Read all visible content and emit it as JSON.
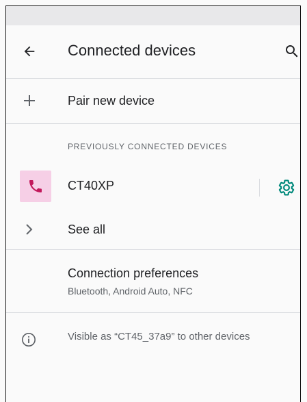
{
  "app_bar": {
    "title": "Connected devices",
    "back_icon": "arrow-back-icon",
    "search_icon": "search-icon"
  },
  "pair_new": {
    "label": "Pair new device",
    "icon": "plus-icon"
  },
  "previously_connected": {
    "header": "PREVIOUSLY CONNECTED DEVICES",
    "devices": [
      {
        "name": "CT40XP",
        "icon": "phone-icon",
        "settings_icon": "gear-icon"
      }
    ],
    "see_all_label": "See all",
    "see_all_icon": "chevron-right-icon"
  },
  "connection_preferences": {
    "label": "Connection preferences",
    "summary": "Bluetooth, Android Auto, NFC"
  },
  "visibility": {
    "text": "Visible as “CT45_37a9” to other devices",
    "icon": "info-icon"
  },
  "colors": {
    "accent": "#00897b",
    "device_icon_bg": "#f6cfe6",
    "device_icon_fg": "#c2185b",
    "divider": "#dadce0",
    "secondary_text": "#5f6368"
  }
}
